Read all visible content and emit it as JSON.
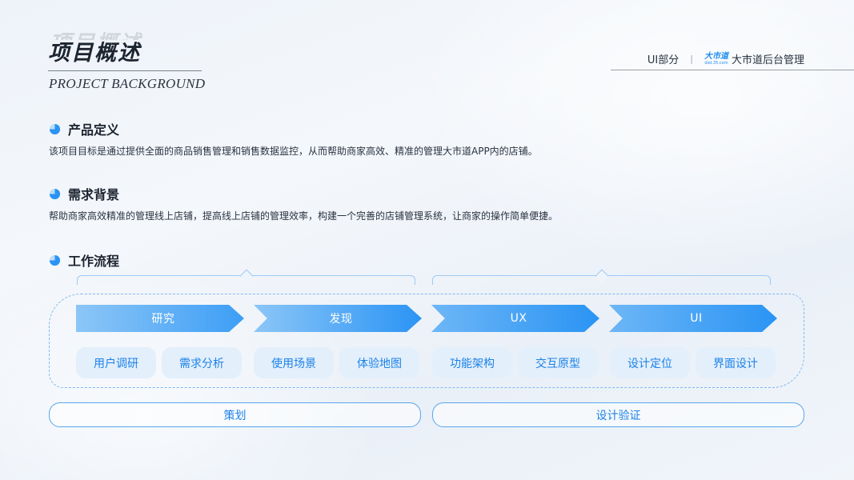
{
  "header": {
    "title": "项目概述",
    "title_ghost": "项目概述",
    "subtitle": "PROJECT BACKGROUND",
    "section_tag": "UI部分",
    "brand_logo": {
      "main": "大市道",
      "sub": "dsd.35.com"
    },
    "brand_name": "大市道后台管理"
  },
  "sections": {
    "definition": {
      "heading": "产品定义",
      "text": "该项目目标是通过提供全面的商品销售管理和销售数据监控，从而帮助商家高效、精准的管理大市道APP内的店铺。"
    },
    "background": {
      "heading": "需求背景",
      "text": "帮助商家高效精准的管理线上店铺，提高线上店铺的管理效率，构建一个完善的店铺管理系统，让商家的操作简单便捷。"
    },
    "workflow": {
      "heading": "工作流程",
      "stages": [
        {
          "label": "研究",
          "tasks": [
            "用户调研",
            "需求分析"
          ]
        },
        {
          "label": "发现",
          "tasks": [
            "使用场景",
            "体验地图"
          ]
        },
        {
          "label": "UX",
          "tasks": [
            "功能架构",
            "交互原型"
          ]
        },
        {
          "label": "UI",
          "tasks": [
            "设计定位",
            "界面设计"
          ]
        }
      ],
      "phases": [
        "策划",
        "设计验证"
      ]
    }
  },
  "colors": {
    "accent": "#1f8bf0",
    "arrow_start": "#8cc6f7",
    "arrow_end": "#2a94f4",
    "pill_bg": "#e3effb",
    "pill_text": "#1c82e8",
    "dashed_border": "#7fb8ef"
  },
  "icons": {
    "section_bullet": "pie-chart-icon"
  }
}
